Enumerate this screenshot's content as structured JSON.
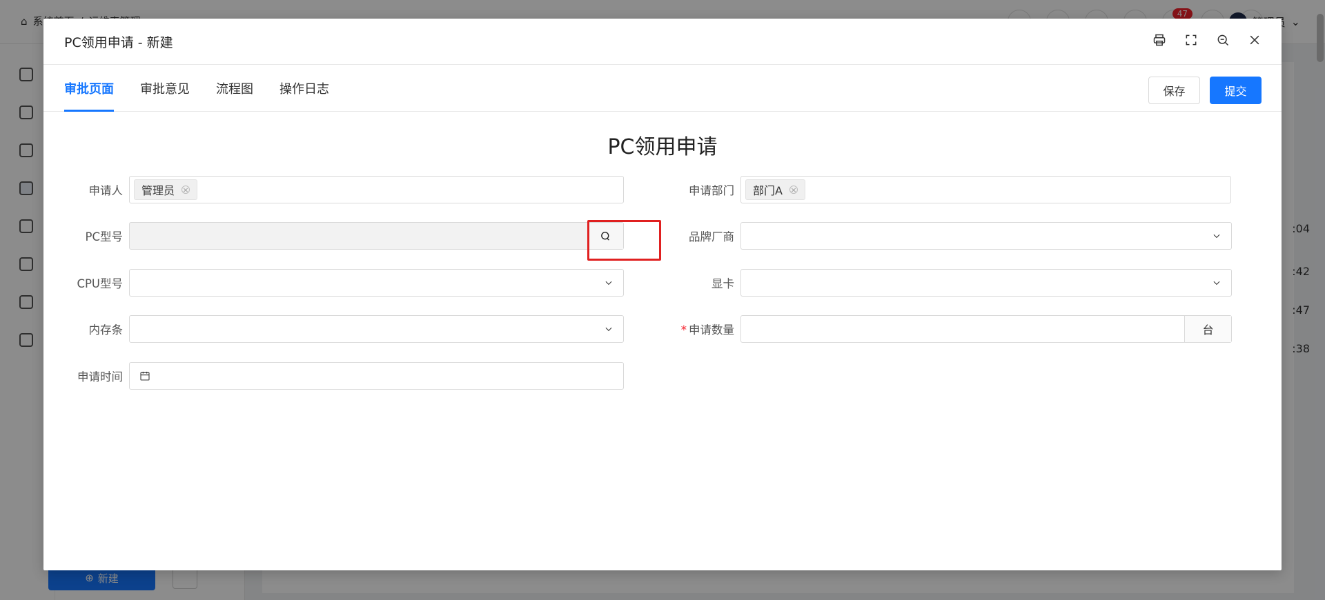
{
  "background": {
    "breadcrumb": [
      "系统首页",
      "/",
      "运维表管理"
    ],
    "badge_count": "47",
    "user_name": "管理员",
    "new_button_label": "新建",
    "right_texts": [
      ":04",
      ":42",
      ":47",
      ":38"
    ]
  },
  "modal": {
    "title": "PC领用申请 - 新建",
    "actions": [
      "print-icon",
      "fullscreen-icon",
      "zoom-out-icon",
      "close-icon"
    ],
    "tabs": [
      {
        "label": "审批页面",
        "active": true
      },
      {
        "label": "审批意见",
        "active": false
      },
      {
        "label": "流程图",
        "active": false
      },
      {
        "label": "操作日志",
        "active": false
      }
    ],
    "save_label": "保存",
    "submit_label": "提交",
    "form_title": "PC领用申请",
    "fields": {
      "applicant": {
        "label": "申请人",
        "tag": "管理员"
      },
      "department": {
        "label": "申请部门",
        "tag": "部门A"
      },
      "pc_model": {
        "label": "PC型号",
        "value": ""
      },
      "brand": {
        "label": "品牌厂商",
        "value": ""
      },
      "cpu": {
        "label": "CPU型号",
        "value": ""
      },
      "gpu": {
        "label": "显卡",
        "value": ""
      },
      "memory": {
        "label": "内存条",
        "value": ""
      },
      "quantity": {
        "label": "申请数量",
        "required_mark": "*",
        "unit": "台",
        "value": ""
      },
      "apply_time": {
        "label": "申请时间",
        "value": ""
      }
    }
  },
  "colors": {
    "primary": "#1677ff",
    "highlight": "#e02020",
    "required": "#f5222d"
  }
}
